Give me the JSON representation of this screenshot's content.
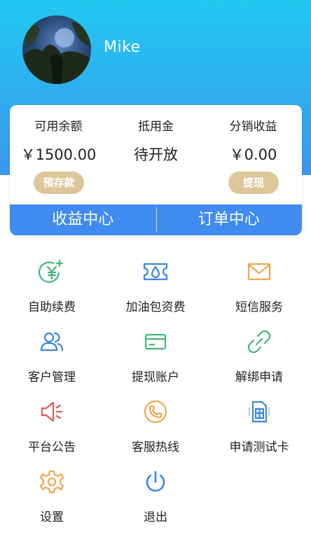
{
  "profile": {
    "name": "Mike"
  },
  "balances": [
    {
      "label": "可用余额",
      "value": "￥1500.00",
      "action": "预存款"
    },
    {
      "label": "抵用金",
      "value": "待开放"
    },
    {
      "label": "分销收益",
      "value": "￥0.00",
      "action": "提现"
    }
  ],
  "centers": {
    "income": "收益中心",
    "orders": "订单中心"
  },
  "menu": [
    {
      "label": "自助续费",
      "icon": "yen-plus-icon"
    },
    {
      "label": "加油包资费",
      "icon": "ticket-drop-icon"
    },
    {
      "label": "短信服务",
      "icon": "envelope-icon"
    },
    {
      "label": "客户管理",
      "icon": "users-icon"
    },
    {
      "label": "提现账户",
      "icon": "card-icon"
    },
    {
      "label": "解绑申请",
      "icon": "unlink-icon"
    },
    {
      "label": "平台公告",
      "icon": "speaker-icon"
    },
    {
      "label": "客服热线",
      "icon": "phone-icon"
    },
    {
      "label": "申请测试卡",
      "icon": "sim-card-icon"
    },
    {
      "label": "设置",
      "icon": "gear-icon"
    },
    {
      "label": "退出",
      "icon": "power-icon"
    }
  ],
  "colors": {
    "header_top": "#21c8f0",
    "header_bottom": "#3a97ee",
    "accent_blue": "#3f8bf0",
    "pill_gold": "#ddc79a",
    "green": "#3fb87a",
    "orange": "#f0a64a",
    "red": "#e05a55",
    "blue": "#3a86e0"
  }
}
